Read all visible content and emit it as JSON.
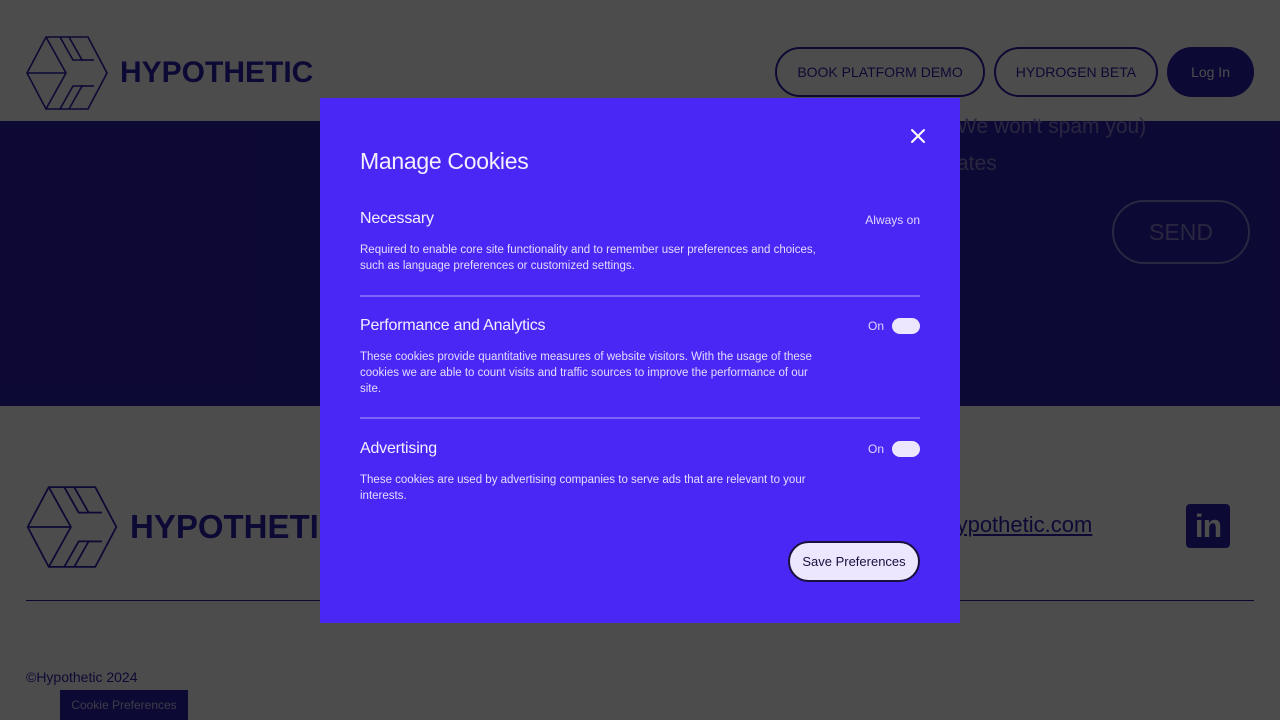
{
  "header": {
    "brand": "HYPOTHETIC",
    "nav": [
      {
        "label": "BOOK PLATFORM DEMO"
      },
      {
        "label": "HYDROGEN BETA"
      },
      {
        "label": "Log In"
      }
    ]
  },
  "hero": {
    "line1_partial": "We won't spam you)",
    "line2_partial": "ates",
    "send_label": "SEND"
  },
  "footer": {
    "brand": "HYPOTHETIC",
    "email_partial": "llo@hypothetic.com",
    "linkedin_glyph": "in",
    "copyright": "©Hypothetic 2024",
    "cookie_preferences_label": "Cookie Preferences"
  },
  "modal": {
    "title": "Manage Cookies",
    "close_icon": "close-icon",
    "sections": [
      {
        "title": "Necessary",
        "status": "Always on",
        "description": "Required to enable core site functionality and to remember user preferences and choices, such as language preferences or customized settings."
      },
      {
        "title": "Performance and Analytics",
        "status": "On",
        "toggle_on": true,
        "description": "These cookies provide quantitative measures of website visitors. With the usage of these cookies we are able to count visits and traffic sources to improve the performance of our site."
      },
      {
        "title": "Advertising",
        "status": "On",
        "toggle_on": true,
        "description": "These cookies are used by advertising companies to serve ads that are relevant to your interests."
      }
    ],
    "save_label": "Save Preferences"
  },
  "colors": {
    "brand": "#2a1fb0",
    "modal_bg": "#4b27f5",
    "modal_text": "#f0ecff",
    "toggle_on": "#ece6ff",
    "overlay": "rgba(0,0,0,0.7)"
  }
}
